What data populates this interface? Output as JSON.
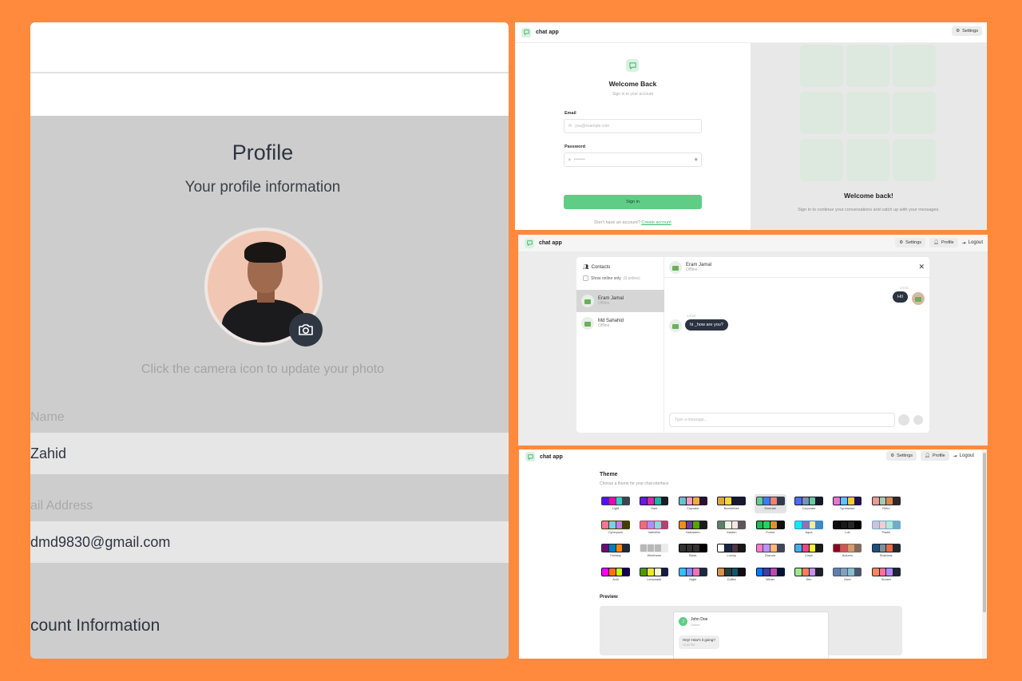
{
  "profile": {
    "title": "Profile",
    "subtitle": "Your profile information",
    "camera_hint": "Click the camera icon to update your photo",
    "name_label": "Name",
    "name_value": "Zahid",
    "email_label": "ail Address",
    "email_value": "dmd9830@gmail.com",
    "account_heading": "count Information"
  },
  "login": {
    "app_name": "chat app",
    "settings": "Settings",
    "welcome": "Welcome Back",
    "welcome_sub": "Sign in to your account",
    "email_label": "Email",
    "email_placeholder": "you@example.com",
    "password_label": "Password",
    "password_placeholder": "••••••••",
    "sign_in": "Sign in",
    "no_account": "Don't have an account?",
    "create_account": "Create account",
    "right_title": "Welcome back!",
    "right_sub": "Sign in to continue your conversations and catch up with your messages."
  },
  "chat": {
    "app_name": "chat app",
    "settings": "Settings",
    "profile": "Profile",
    "logout": "Logout",
    "contacts_title": "Contacts",
    "show_online": "Show online only",
    "online_count": "(0 online)",
    "contacts": [
      {
        "name": "Eram Jamal",
        "status": "Offline"
      },
      {
        "name": "Md Sahahid",
        "status": "Offline"
      }
    ],
    "header_name": "Eram Jamal",
    "header_status": "Offline",
    "messages": [
      {
        "time": "14:51",
        "text": "HII"
      },
      {
        "time": "14:52",
        "text": "hi _how are you?"
      }
    ],
    "composer_placeholder": "Type a message..."
  },
  "theme": {
    "app_name": "chat app",
    "settings": "Settings",
    "profile": "Profile",
    "logout": "Logout",
    "title": "Theme",
    "subtitle": "Choose a theme for your chat interface",
    "preview_title": "Preview",
    "preview_name": "John Doe",
    "preview_status": "Online",
    "preview_initial": "J",
    "preview_message": "Hey! How's it going?",
    "preview_time": "12:00 PM",
    "selected": "Emerald",
    "themes": [
      {
        "name": "Light",
        "colors": [
          "#570df8",
          "#f000b8",
          "#37cdbe",
          "#3d4451"
        ]
      },
      {
        "name": "Dark",
        "colors": [
          "#661ae6",
          "#d926aa",
          "#1fb2a5",
          "#191d24"
        ]
      },
      {
        "name": "Cupcake",
        "colors": [
          "#65c3c8",
          "#ef9fbc",
          "#eeaf3a",
          "#291334"
        ]
      },
      {
        "name": "Bumblebee",
        "colors": [
          "#e0a82e",
          "#f9d72f",
          "#181830",
          "#181830"
        ]
      },
      {
        "name": "Emerald",
        "colors": [
          "#66cc8a",
          "#377cfb",
          "#f68067",
          "#333c4d"
        ]
      },
      {
        "name": "Corporate",
        "colors": [
          "#4b6bfb",
          "#7b92b2",
          "#67cba0",
          "#181a2a"
        ]
      },
      {
        "name": "Synthwave",
        "colors": [
          "#e779c1",
          "#58c7f3",
          "#f3cc30",
          "#20134e"
        ]
      },
      {
        "name": "Retro",
        "colors": [
          "#ef9995",
          "#a4cbb4",
          "#dc8850",
          "#2e282a"
        ]
      },
      {
        "name": "Cyberpunk",
        "colors": [
          "#ff7598",
          "#75d1f0",
          "#c07eec",
          "#423f00"
        ]
      },
      {
        "name": "Valentine",
        "colors": [
          "#e96d7b",
          "#a991f7",
          "#88dbdd",
          "#af4670"
        ]
      },
      {
        "name": "Halloween",
        "colors": [
          "#f28c18",
          "#6d3a9c",
          "#51a800",
          "#1b1d1d"
        ]
      },
      {
        "name": "Garden",
        "colors": [
          "#5c7f67",
          "#ecf4e7",
          "#fae5e5",
          "#5d5656"
        ]
      },
      {
        "name": "Forest",
        "colors": [
          "#1eb854",
          "#1fd65f",
          "#d99330",
          "#110e0e"
        ]
      },
      {
        "name": "Aqua",
        "colors": [
          "#09ecf3",
          "#966fb3",
          "#ffe999",
          "#3b8ac4"
        ]
      },
      {
        "name": "Lofi",
        "colors": [
          "#0d0d0d",
          "#1a1919",
          "#262626",
          "#000000"
        ]
      },
      {
        "name": "Pastel",
        "colors": [
          "#d1c1d7",
          "#f6cbd1",
          "#b4e9d6",
          "#70acc7"
        ]
      },
      {
        "name": "Fantasy",
        "colors": [
          "#6e0b75",
          "#007ebd",
          "#f8860d",
          "#1f2937"
        ]
      },
      {
        "name": "Wireframe",
        "colors": [
          "#b8b8b8",
          "#b8b8b8",
          "#b8b8b8",
          "#ebebeb"
        ]
      },
      {
        "name": "Black",
        "colors": [
          "#343232",
          "#343232",
          "#343232",
          "#000000"
        ]
      },
      {
        "name": "Luxury",
        "colors": [
          "#ffffff",
          "#152747",
          "#513448",
          "#171618"
        ]
      },
      {
        "name": "Dracula",
        "colors": [
          "#ff79c6",
          "#bd93f9",
          "#ffb86c",
          "#414558"
        ]
      },
      {
        "name": "Cmyk",
        "colors": [
          "#45aeee",
          "#e8488a",
          "#fff232",
          "#1a1a1a"
        ]
      },
      {
        "name": "Autumn",
        "colors": [
          "#8c0327",
          "#d85251",
          "#d59b6a",
          "#826a5c"
        ]
      },
      {
        "name": "Business",
        "colors": [
          "#1c4e80",
          "#7c909a",
          "#ea6947",
          "#23282e"
        ]
      },
      {
        "name": "Acid",
        "colors": [
          "#ff00f4",
          "#ff7400",
          "#cbfd03",
          "#140152"
        ]
      },
      {
        "name": "Lemonade",
        "colors": [
          "#519903",
          "#e9e92e",
          "#f7f9ca",
          "#191a3e"
        ]
      },
      {
        "name": "Night",
        "colors": [
          "#38bdf8",
          "#818cf8",
          "#f471b5",
          "#1e293b"
        ]
      },
      {
        "name": "Coffee",
        "colors": [
          "#db924b",
          "#263e3f",
          "#10576d",
          "#120c12"
        ]
      },
      {
        "name": "Winter",
        "colors": [
          "#047aff",
          "#463aa2",
          "#c148ac",
          "#021431"
        ]
      },
      {
        "name": "Dim",
        "colors": [
          "#9fe88d",
          "#ff7d5c",
          "#c792e9",
          "#1c212b"
        ]
      },
      {
        "name": "Nord",
        "colors": [
          "#5e81ac",
          "#81a1c1",
          "#88c0d0",
          "#4c566a"
        ]
      },
      {
        "name": "Sunset",
        "colors": [
          "#ff865b",
          "#fd6f9c",
          "#b387fa",
          "#1c2630"
        ]
      }
    ]
  }
}
